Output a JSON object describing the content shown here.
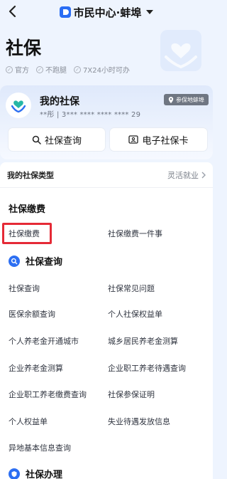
{
  "header": {
    "title": "市民中心·蚌埠"
  },
  "hero": {
    "title": "社保",
    "badges": [
      "官方",
      "不跑腿",
      "7X24小时可办"
    ]
  },
  "card": {
    "title": "我的社保",
    "id_masked": "**彤 | 3*** **** **** **** 29",
    "place_chip": "参保地蚌埠",
    "btn_query": "社保查询",
    "btn_card": "电子社保卡"
  },
  "type_row": {
    "label": "我的社保类型",
    "value": "灵活就业"
  },
  "sections": {
    "payment": {
      "title": "社保缴费",
      "items": [
        "社保缴费",
        "社保缴费一件事"
      ]
    },
    "query": {
      "title": "社保查询",
      "items": [
        "社保查询",
        "社保常见问题",
        "医保余额查询",
        "个人社保权益单",
        "个人养老金开通城市",
        "城乡居民养老金测算",
        "企业养老金测算",
        "企业职工养老待遇查询",
        "企业职工养老缴费查询",
        "社保参保证明",
        "个人权益单",
        "失业待遇发放信息",
        "异地基本信息查询"
      ]
    },
    "handle": {
      "title": "社保办理"
    }
  },
  "colors": {
    "accent": "#2d6ff2",
    "highlight": "#e52a36"
  }
}
